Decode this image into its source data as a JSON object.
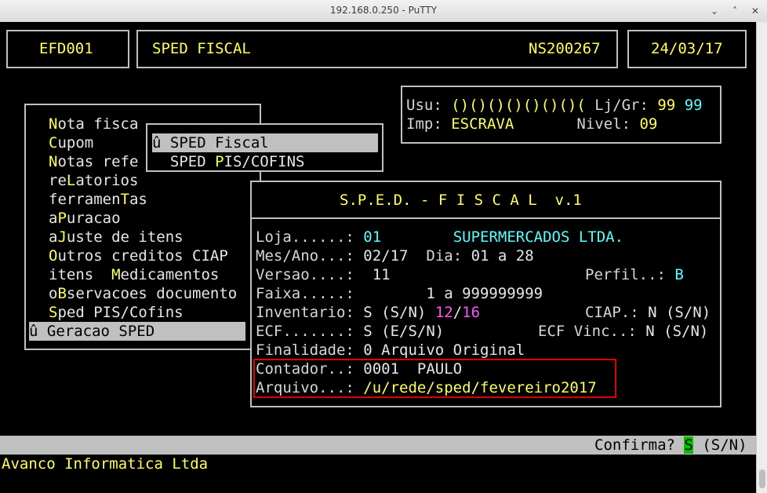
{
  "window": {
    "title": "192.168.0.250 - PuTTY",
    "minimize": "⌄",
    "maximize": "˄",
    "close": "✕"
  },
  "header": {
    "code": "EFD001",
    "module": "SPED FISCAL",
    "serial": "NS200267",
    "date": "24/03/17"
  },
  "user": {
    "usu_label": "Usu:",
    "usu_value": "()()()()()()()(",
    "ljgr_label": "Lj/Gr:",
    "lj": "99",
    "gr": "99",
    "imp_label": "Imp:",
    "imp_value": "ESCRAVA",
    "nivel_label": "Nivel:",
    "nivel_value": "09"
  },
  "menu": {
    "items": [
      {
        "pre": "",
        "hot": "N",
        "post": "ota fisca"
      },
      {
        "pre": "",
        "hot": "C",
        "post": "upom"
      },
      {
        "pre": "",
        "hot": "N",
        "post": "otas refe"
      },
      {
        "pre": "re",
        "hot": "L",
        "post": "atorios"
      },
      {
        "pre": "ferramen",
        "hot": "T",
        "post": "as"
      },
      {
        "pre": "a",
        "hot": "P",
        "post": "uracao"
      },
      {
        "pre": "a",
        "hot": "J",
        "post": "uste de itens"
      },
      {
        "pre": "",
        "hot": "O",
        "post": "utros creditos CIAP"
      },
      {
        "pre": "itens  ",
        "hot": "M",
        "post": "edicamentos"
      },
      {
        "pre": "o",
        "hot": "B",
        "post": "servacoes documento"
      },
      {
        "pre": "",
        "hot": "S",
        "post": "ped PIS/Cofins"
      }
    ],
    "selected": "û Geracao SPED"
  },
  "submenu": {
    "selected": "û SPED Fiscal",
    "item2_pre": "  SPED ",
    "item2_hot": "P",
    "item2_post": "IS/COFINS"
  },
  "dialog": {
    "title": "S.P.E.D. - F I S C A L  v.1",
    "loja_label": "Loja......:",
    "loja_value": "01",
    "loja_name": "SUPERMERCADOS LTDA.",
    "mes_label": "Mes/Ano...:",
    "mes_value": "02/17",
    "dia_label": "Dia:",
    "dia_value": "01 a 28",
    "versao_label": "Versao....:",
    "versao_value": "11",
    "perfil_label": "Perfil..:",
    "perfil_value": "B",
    "faixa_label": "Faixa.....:",
    "faixa_value": "1 a 999999999",
    "inv_label": "Inventario:",
    "inv_value": "S (S/N)",
    "inv_a": "12",
    "inv_sep": "/",
    "inv_b": "16",
    "ciap_label": "CIAP.:",
    "ciap_value": "N (S/N)",
    "ecf_label": "ECF.......:",
    "ecf_value": "S (E/S/N)",
    "ecfv_label": "ECF Vinc..:",
    "ecfv_value": "N (S/N)",
    "fin_label": "Finalidade:",
    "fin_value": "0 Arquivo Original",
    "cont_label": "Contador..:",
    "cont_value": "0001  PAULO",
    "arq_label": "Arquivo...:",
    "arq_value": "/u/rede/sped/fevereiro2017"
  },
  "status": {
    "prompt": "Confirma?",
    "answer": "S",
    "options": "(S/N)"
  },
  "footer": {
    "company": "Avanco Informatica Ltda"
  }
}
